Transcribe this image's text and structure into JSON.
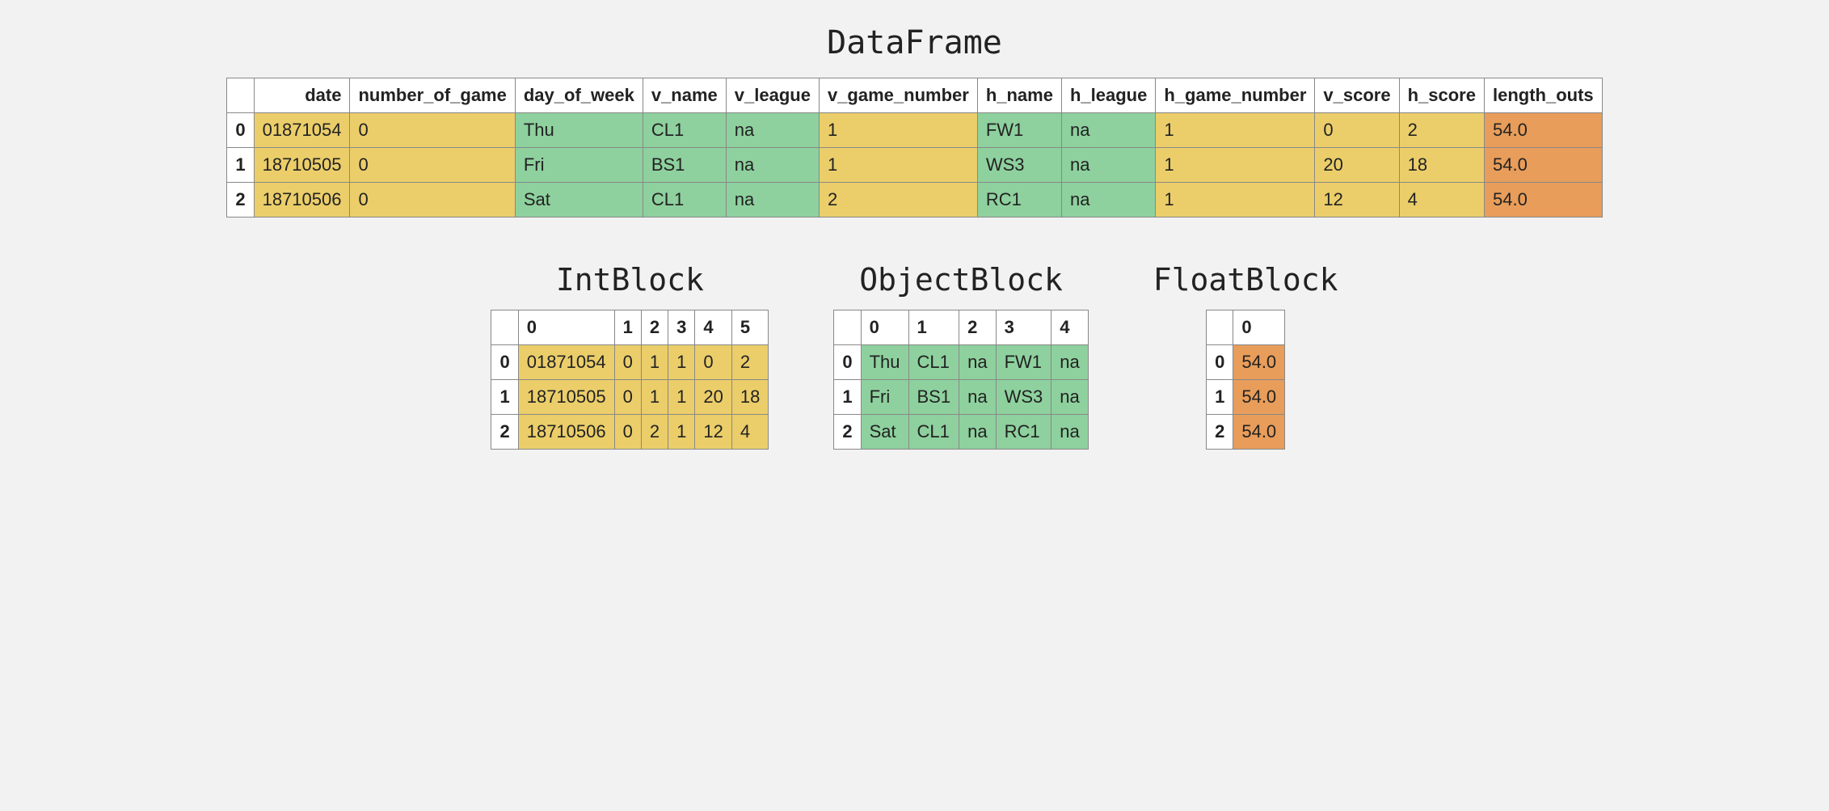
{
  "titles": {
    "main": "DataFrame",
    "int": "IntBlock",
    "obj": "ObjectBlock",
    "float": "FloatBlock"
  },
  "df": {
    "columns": [
      "date",
      "number_of_game",
      "day_of_week",
      "v_name",
      "v_league",
      "v_game_number",
      "h_name",
      "h_league",
      "h_game_number",
      "v_score",
      "h_score",
      "length_outs"
    ],
    "col_types": [
      "int",
      "int",
      "obj",
      "obj",
      "obj",
      "int",
      "obj",
      "obj",
      "int",
      "int",
      "int",
      "float"
    ],
    "index": [
      "0",
      "1",
      "2"
    ],
    "rows": [
      [
        "01871054",
        "0",
        "Thu",
        "CL1",
        "na",
        "1",
        "FW1",
        "na",
        "1",
        "0",
        "2",
        "54.0"
      ],
      [
        "18710505",
        "0",
        "Fri",
        "BS1",
        "na",
        "1",
        "WS3",
        "na",
        "1",
        "20",
        "18",
        "54.0"
      ],
      [
        "18710506",
        "0",
        "Sat",
        "CL1",
        "na",
        "2",
        "RC1",
        "na",
        "1",
        "12",
        "4",
        "54.0"
      ]
    ]
  },
  "intblock": {
    "columns": [
      "0",
      "1",
      "2",
      "3",
      "4",
      "5"
    ],
    "index": [
      "0",
      "1",
      "2"
    ],
    "rows": [
      [
        "01871054",
        "0",
        "1",
        "1",
        "0",
        "2"
      ],
      [
        "18710505",
        "0",
        "1",
        "1",
        "20",
        "18"
      ],
      [
        "18710506",
        "0",
        "2",
        "1",
        "12",
        "4"
      ]
    ]
  },
  "objblock": {
    "columns": [
      "0",
      "1",
      "2",
      "3",
      "4"
    ],
    "index": [
      "0",
      "1",
      "2"
    ],
    "rows": [
      [
        "Thu",
        "CL1",
        "na",
        "FW1",
        "na"
      ],
      [
        "Fri",
        "BS1",
        "na",
        "WS3",
        "na"
      ],
      [
        "Sat",
        "CL1",
        "na",
        "RC1",
        "na"
      ]
    ]
  },
  "floatblock": {
    "columns": [
      "0"
    ],
    "index": [
      "0",
      "1",
      "2"
    ],
    "rows": [
      [
        "54.0"
      ],
      [
        "54.0"
      ],
      [
        "54.0"
      ]
    ]
  }
}
